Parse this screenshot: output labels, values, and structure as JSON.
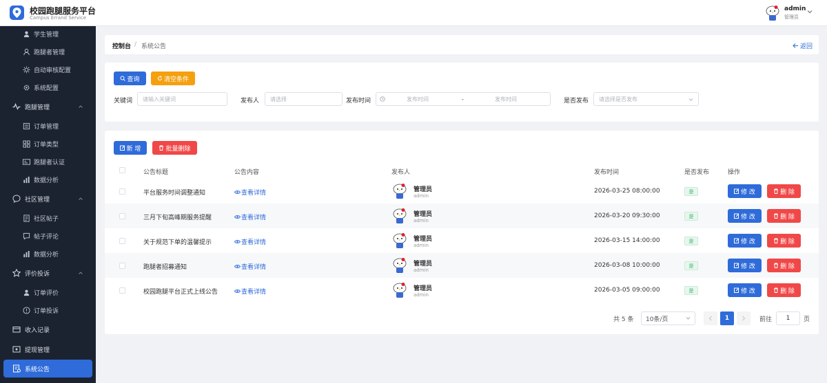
{
  "header": {
    "brand_title": "校园跑腿服务平台",
    "brand_subtitle": "Campus Errand Service",
    "user_name": "admin",
    "user_role": "管理员"
  },
  "sidebar": {
    "items": [
      {
        "label": "学生管理",
        "icon": "user-icon",
        "level": 2
      },
      {
        "label": "跑腿者管理",
        "icon": "runner-icon",
        "level": 2
      },
      {
        "label": "自动审核配置",
        "icon": "sun-gear-icon",
        "level": 2
      },
      {
        "label": "系统配置",
        "icon": "gear-icon",
        "level": 2
      },
      {
        "label": "跑腿管理",
        "icon": "pulse-icon",
        "level": 1
      },
      {
        "label": "订单管理",
        "icon": "list-icon",
        "level": 2
      },
      {
        "label": "订单类型",
        "icon": "grid-icon",
        "level": 2
      },
      {
        "label": "跑腿者认证",
        "icon": "id-card-icon",
        "level": 2
      },
      {
        "label": "数据分析",
        "icon": "bar-chart-icon",
        "level": 2
      },
      {
        "label": "社区管理",
        "icon": "chat-icon",
        "level": 1
      },
      {
        "label": "社区帖子",
        "icon": "document-icon",
        "level": 2
      },
      {
        "label": "帖子评论",
        "icon": "comment-icon",
        "level": 2
      },
      {
        "label": "数据分析",
        "icon": "bar-chart-icon",
        "level": 2
      },
      {
        "label": "评价投诉",
        "icon": "star-icon",
        "level": 1
      },
      {
        "label": "订单评价",
        "icon": "user-icon",
        "level": 2
      },
      {
        "label": "订单投诉",
        "icon": "alert-icon",
        "level": 2
      },
      {
        "label": "收入记录",
        "icon": "wallet-icon",
        "level": 1
      },
      {
        "label": "提现管理",
        "icon": "withdraw-icon",
        "level": 1
      },
      {
        "label": "系统公告",
        "icon": "notice-icon",
        "level": 1,
        "active": true
      }
    ]
  },
  "breadcrumb": {
    "root": "控制台",
    "separator": "/",
    "current": "系统公告",
    "back_label": "返回"
  },
  "filter": {
    "search_label": "查询",
    "reset_label": "清空条件",
    "keyword_label": "关键词",
    "keyword_placeholder": "请输入关键词",
    "publisher_label": "发布人",
    "publisher_placeholder": "请选择",
    "time_label": "发布时间",
    "time_start_placeholder": "发布时间",
    "time_sep": "-",
    "time_end_placeholder": "发布时间",
    "published_label": "是否发布",
    "published_placeholder": "请选择是否发布"
  },
  "toolbar": {
    "add_label": "新 增",
    "batch_delete_label": "批量删除"
  },
  "table": {
    "columns": [
      "公告标题",
      "公告内容",
      "发布人",
      "发布时间",
      "是否发布",
      "操作"
    ],
    "rows": [
      {
        "title": "平台服务时间调整通知",
        "content": "查看详情",
        "publisher": "管理员",
        "account": "admin",
        "time": "2026-03-25 08:00:00",
        "published": "是",
        "edit": "修 改",
        "delete": "删 除"
      },
      {
        "title": "三月下旬高峰期服务提醒",
        "content": "查看详情",
        "publisher": "管理员",
        "account": "admin",
        "time": "2026-03-20 09:30:00",
        "published": "是",
        "edit": "修 改",
        "delete": "删 除"
      },
      {
        "title": "关于规范下单的温馨提示",
        "content": "查看详情",
        "publisher": "管理员",
        "account": "admin",
        "time": "2026-03-15 14:00:00",
        "published": "是",
        "edit": "修 改",
        "delete": "删 除"
      },
      {
        "title": "跑腿者招募通知",
        "content": "查看详情",
        "publisher": "管理员",
        "account": "admin",
        "time": "2026-03-08 10:00:00",
        "published": "是",
        "edit": "修 改",
        "delete": "删 除"
      },
      {
        "title": "校园跑腿平台正式上线公告",
        "content": "查看详情",
        "publisher": "管理员",
        "account": "admin",
        "time": "2026-03-05 09:00:00",
        "published": "是",
        "edit": "修 改",
        "delete": "删 除"
      }
    ]
  },
  "pagination": {
    "total": "共 5 条",
    "page_size": "10条/页",
    "current_page": "1",
    "goto_label": "前往",
    "goto_value": "1",
    "page_suffix": "页"
  },
  "colors": {
    "primary": "#2f6bd9",
    "warning": "#f5a00f",
    "danger": "#f04848",
    "sidebar_bg": "#1c2330",
    "success": "#3bb56c"
  }
}
